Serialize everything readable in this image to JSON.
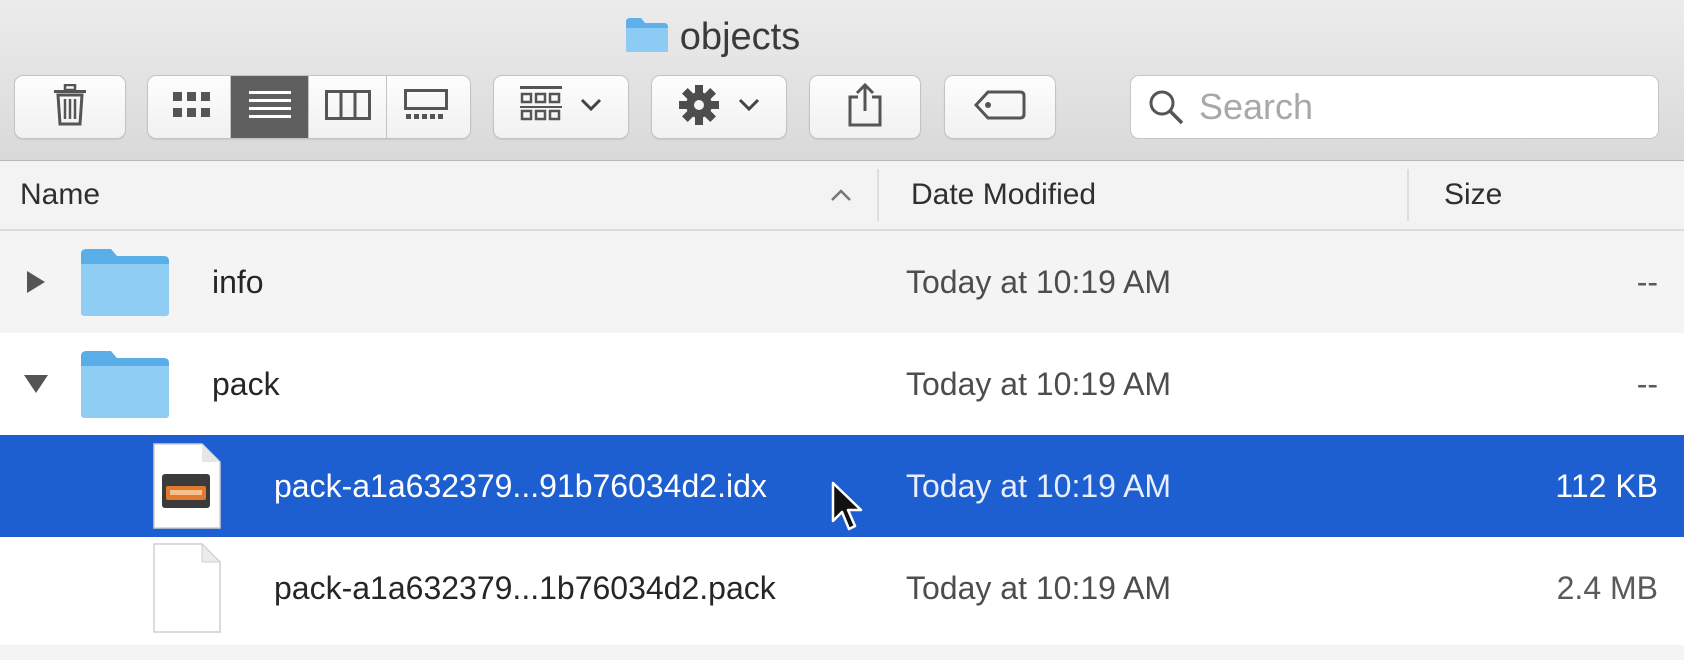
{
  "window": {
    "title": "objects"
  },
  "toolbar": {
    "buttons": [
      {
        "name": "trash-button",
        "icon": "trash-icon"
      },
      {
        "name": "view-icon-button",
        "icon": "grid-icon"
      },
      {
        "name": "view-list-button",
        "icon": "list-icon",
        "active": true
      },
      {
        "name": "view-columns-button",
        "icon": "columns-icon"
      },
      {
        "name": "view-gallery-button",
        "icon": "gallery-icon"
      },
      {
        "name": "group-button",
        "icon": "group-grid-icon"
      },
      {
        "name": "action-button",
        "icon": "gear-icon"
      },
      {
        "name": "share-button",
        "icon": "share-icon"
      },
      {
        "name": "tags-button",
        "icon": "tag-icon"
      }
    ],
    "search": {
      "placeholder": "Search",
      "value": ""
    }
  },
  "columns": {
    "name": "Name",
    "date_modified": "Date Modified",
    "size": "Size",
    "sort_indicator": "ascending"
  },
  "files": [
    {
      "name": "info",
      "kind": "folder",
      "disclosure": "collapsed",
      "date": "Today at 10:19 AM",
      "size": "--"
    },
    {
      "name": "pack",
      "kind": "folder",
      "disclosure": "expanded",
      "date": "Today at 10:19 AM",
      "size": "--"
    },
    {
      "name": "pack-a1a632379...91b76034d2.idx",
      "kind": "idx-file",
      "date": "Today at 10:19 AM",
      "size": "112 KB",
      "selected": true
    },
    {
      "name": "pack-a1a632379...1b76034d2.pack",
      "kind": "document",
      "date": "Today at 10:19 AM",
      "size": "2.4 MB"
    }
  ],
  "colors": {
    "selection": "#1d5fd0",
    "folder": "#7cc0ef",
    "toolbar": "#e3e3e3"
  }
}
